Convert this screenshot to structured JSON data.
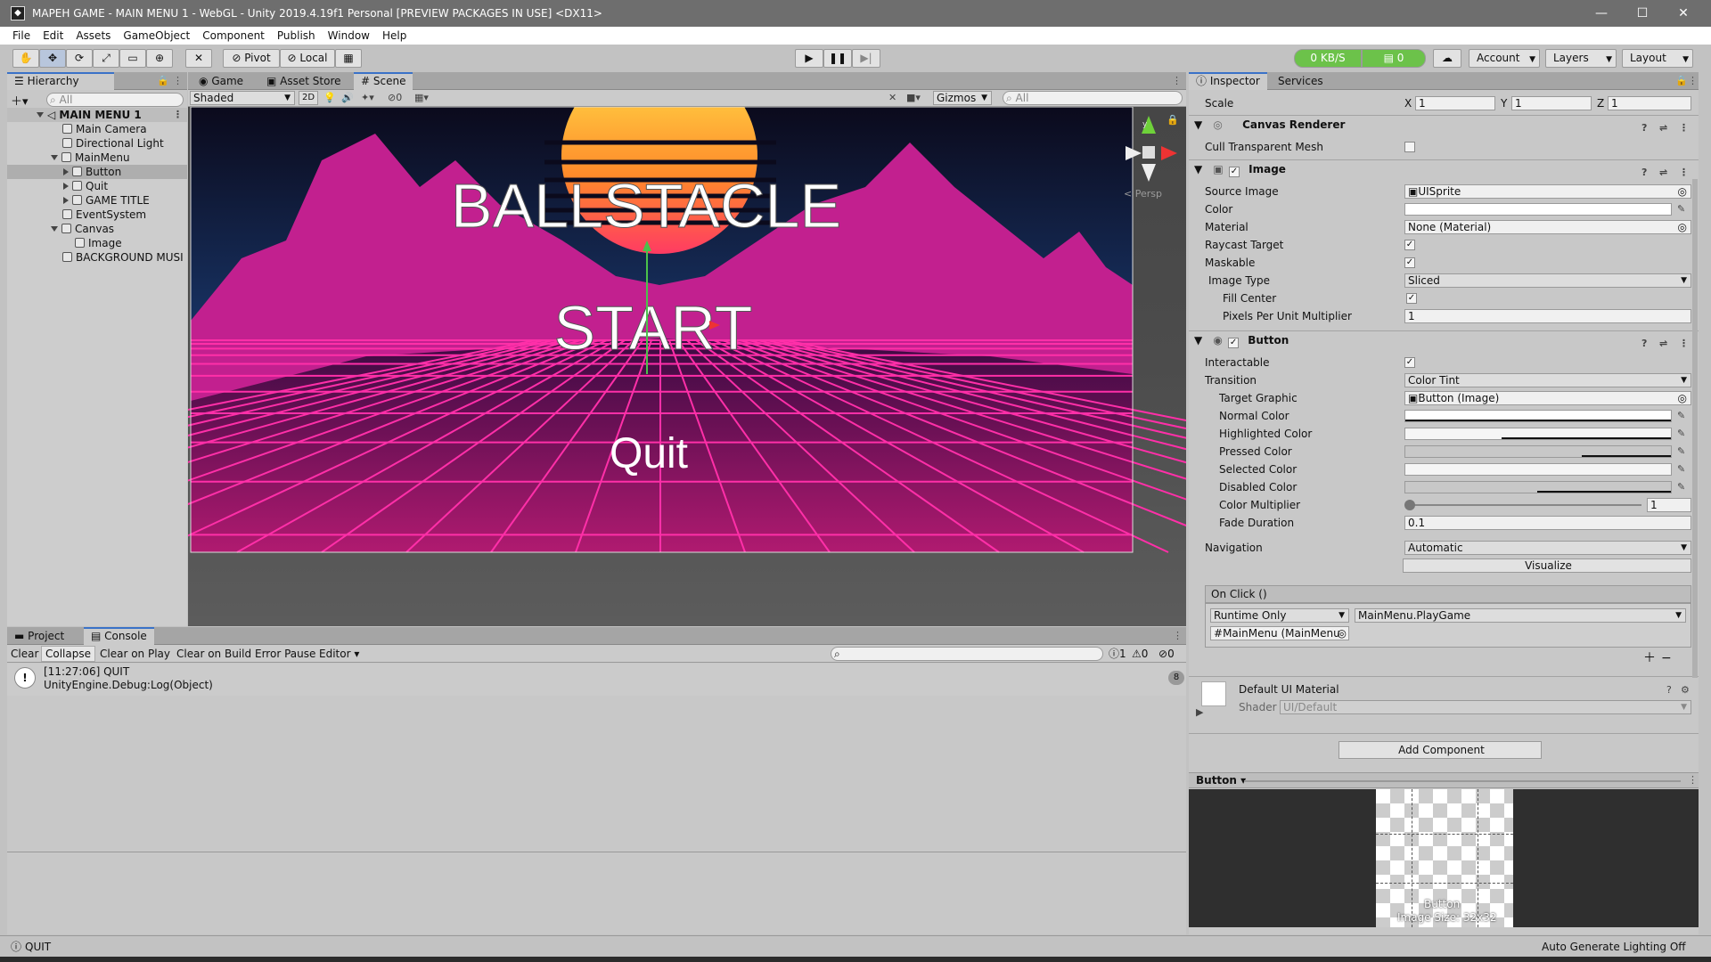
{
  "window": {
    "title": "MAPEH GAME - MAIN MENU 1 - WebGL - Unity 2019.4.19f1 Personal [PREVIEW PACKAGES IN USE] <DX11>"
  },
  "menu": [
    "File",
    "Edit",
    "Assets",
    "GameObject",
    "Component",
    "Publish",
    "Window",
    "Help"
  ],
  "toolbar": {
    "pivot": "Pivot",
    "local": "Local",
    "net": "0 KB/S",
    "count": "0",
    "account": "Account",
    "layers": "Layers",
    "layout": "Layout"
  },
  "hierarchy": {
    "tab": "Hierarchy",
    "search": "All",
    "scene": "MAIN MENU 1",
    "items": [
      "Main Camera",
      "Directional Light",
      "MainMenu",
      "Button",
      "Quit",
      "GAME TITLE",
      "EventSystem",
      "Canvas",
      "Image",
      "BACKGROUND MUSI"
    ]
  },
  "scene_tabs": {
    "game": "Game",
    "asset_store": "Asset Store",
    "scene": "Scene"
  },
  "scene_toolbar": {
    "shading": "Shaded",
    "mode2d": "2D",
    "hidden": "0",
    "gizmos": "Gizmos",
    "search": "All",
    "persp": "< Persp",
    "axis_y": "y"
  },
  "scene_view": {
    "title": "BALLSTACLE",
    "start": "START",
    "quit": "Quit"
  },
  "console": {
    "tab_project": "Project",
    "tab_console": "Console",
    "buttons": [
      "Clear",
      "Collapse",
      "Clear on Play",
      "Clear on Build",
      "Error Pause",
      "Editor"
    ],
    "counts": {
      "log": "1",
      "warn": "0",
      "error": "0"
    },
    "entry": {
      "line1": "[11:27:06] QUIT",
      "line2": "UnityEngine.Debug:Log(Object)",
      "count": "8"
    }
  },
  "inspector": {
    "tab_inspector": "Inspector",
    "tab_services": "Services",
    "scale": {
      "label": "Scale",
      "x": "1",
      "y": "1",
      "z": "1"
    },
    "canvas_renderer": {
      "title": "Canvas Renderer",
      "cull": "Cull Transparent Mesh"
    },
    "image": {
      "title": "Image",
      "source_label": "Source Image",
      "source": "UISprite",
      "color": "Color",
      "material_label": "Material",
      "material": "None (Material)",
      "raycast": "Raycast Target",
      "maskable": "Maskable",
      "type_label": "Image Type",
      "type": "Sliced",
      "fill": "Fill Center",
      "ppu_label": "Pixels Per Unit Multiplier",
      "ppu": "1"
    },
    "button": {
      "title": "Button",
      "interactable": "Interactable",
      "transition_label": "Transition",
      "transition": "Color Tint",
      "target_label": "Target Graphic",
      "target": "Button (Image)",
      "normal": "Normal Color",
      "highlighted": "Highlighted Color",
      "pressed": "Pressed Color",
      "selected": "Selected Color",
      "disabled": "Disabled Color",
      "multiplier_label": "Color Multiplier",
      "multiplier": "1",
      "fade_label": "Fade Duration",
      "fade": "0.1",
      "nav_label": "Navigation",
      "nav": "Automatic",
      "visualize": "Visualize"
    },
    "onclick": {
      "title": "On Click ()",
      "runtime": "Runtime Only",
      "function": "MainMenu.PlayGame",
      "object": "MainMenu (MainMenu"
    },
    "material": {
      "title": "Default UI Material",
      "shader_label": "Shader",
      "shader": "UI/Default"
    },
    "add_component": "Add Component",
    "preview": {
      "title": "Button",
      "name": "Button",
      "size": "Image Size: 32x32"
    }
  },
  "status": {
    "message": "QUIT",
    "lighting": "Auto Generate Lighting Off"
  }
}
